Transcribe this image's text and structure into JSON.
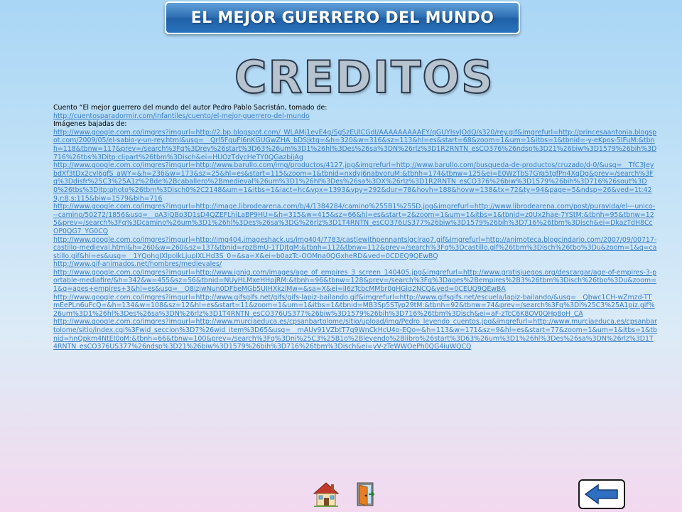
{
  "header": {
    "title": "EL MEJOR GUERRERO DEL MUNDO"
  },
  "main": {
    "heading": "CREDITOS",
    "intro_text": "Cuento “El mejor guerrero del mundo del autor Pedro Pablo Sacristán, tomado de:",
    "story_link": "http://cuentosparadormir.com/infantiles/cuento/el-mejor-guerrero-del-mundo",
    "images_label": "Imágenes bajadas de:",
    "image_links": [
      "http://www.google.com.co/imgres?imgurl=http://2.bp.blogspot.com/_WLAMj1evE4g/SgSzEUlCGdI/AAAAAAAAAEY/qGUYIsvJOdQ/s320/rey.gif&imgrefurl=http://princesaantonia.blogspot.com/2009/05/el-sabio-y-un-rey.html&usg=__Qrl5FguFI6nKGUGwZHA_bDSJktg=&h=320&w=316&sz=113&hl=es&start=68&zoom=1&um=1&itbs=1&tbnid=-y-eKpos-5IFuM:&tbnh=118&tbnw=117&prev=/search%3Fq%3Drey%26start%3D63%26um%3D1%26hl%3Des%26sa%3DN%26rlz%3D1R2RNTN_esCO376%26ndsp%3D21%26biw%3D1579%26bih%3D716%26tbs%3Ditp:clipart%26tbm%3Disch&ei=HUOzTdycHeTY0QGazbijAg",
      "http://www.google.com.co/imgres?imgurl=http://www.barullo.com/img/productos/4127.jpg&imgrefurl=http://www.barullo.com/busqueda-de-productos/cruzado/d-0/&usg=__TfC3JeybdXf3tDx2cvl6gfS_aWY=&h=236&w=173&sz=25&hl=es&start=115&zoom=1&tbnid=nxdyj6nabvoruM:&tbnh=174&tbnw=125&ei=E0WzTbS7GYa5tgfPn4XqDg&prev=/search%3Fq%3Ddisfr%25C3%25A1z%2Bde%2Bcaballero%2Bmedieval%26um%3D1%26hl%3Des%26sa%3DX%26rlz%3D1R2RNTN_esCO376%26biw%3D1579%26bih%3D716%26sout%3D0%26tbs%3Ditp:photo%26tbm%3Disch0%2C2148&um=1&itbs=1&iact=hc&vpx=1393&vpy=292&dur=78&hovh=188&hovw=138&tx=72&ty=94&page=5&ndsp=26&ved=1t:429,r:8,s:115&biw=1579&bih=716",
      "http://www.google.com.co/imgres?imgurl=http://image.librodearena.com/b/4/1384284/camino%255B1%255D.jpg&imgrefurl=http://www.librodearena.com/post/puravida/el---unico---camino/50272/1856&usg=__oA3jQBp3D1sD4QZEFLhiLaBP9HU=&h=315&w=415&sz=66&hl=es&start=2&zoom=1&um=1&itbs=1&tbnid=z0Ux2hae-7YStM:&tbnh=95&tbnw=125&prev=/search%3Fq%3Dcamino%26um%3D1%26hl%3Des%26sa%3DG%26rlz%3D1T4RNTN_esCO376US377%26biw%3D1579%26bih%3D716%26tbm%3Disch&ei=DkazTdH8CcOP0QG7_YG0CQ",
      "http://www.google.com.co/imgres?imgurl=http://img404.imageshack.us/img404/7783/castlewithpennantslgclrao7.gif&imgrefurl=http://animoteca.blogcindario.com/2007/09/00717-castillo-medieval.html&h=260&w=260&sz=137&tbnid=rpzBmU-1TDJtgM:&tbnh=112&tbnw=112&prev=/search%3Fq%3Dcastillo.gif%26tbm%3Disch%26tbo%3Du&zoom=1&q=castillo.gif&hl=es&usg=__1YQohgJXlpolkLjuplXLHd3S_0=&sa=X&ei=b0azTc-OOMna0QGxheRD&ved=0CDEQ9QEwBQ",
      "http://www.gif-animados.net/hombres/medievales/",
      "http://www.google.com.co/imgres?imgurl=http://www.ignig.com/images/age_of_empires_3_screen_140405.jpg&imgrefurl=http://www.gratisjuegos.org/descargar/age-of-empires-3-portable-mediafire/&h=342&w=455&sz=56&tbnid=NUyHLMxeHHpjRM:&tbnh=96&tbnw=128&prev=/search%3Fq%3Dages%2Bempires%2B3%26tbm%3Disch%26tbo%3Du&zoom=1&q=ages+empires+3&hl=es&usg=__O8izjwNun0DFbeMGb5UIHXkzlMw=&sa=X&ei=iI6zTcbcMMbr0gHGlq2NCQ&ved=0CEUQ9QEwBA",
      "http://www.google.com.co/imgres?imgurl=http://www.gifsgifs.net/gifs/gifs-lapiz-bailando.gif&imgrefurl=http://www.gifsgifs.net/escuela/lapiz-bailando/&usg=__Qbwc1CH-wZmzd-TTmEePLn6uFcQ=&h=134&w=108&sz=12&hl=es&start=11&zoom=1&um=1&itbs=1&tbnid=MB3Sp5STyp29tM:&tbnh=92&tbnw=74&prev=/search%3Fq%3Dl%25C3%25A1piz.gif%26um%3D1%26hl%3Des%26sa%3DN%26rlz%3D1T4RNTN_esCO376US377%26biw%3D1579%26bih%3D716%26tbm%3Disch&ei=aF-zTcC6K8OV0QHp8oH_CA",
      "http://www.google.com.co/imgres?imgurl=http://www.murciaeduca.es/cpsanbartolome/sitio/upload/img/Pedro_leyendo_cuentos.jpg&imgrefurl=http://www.murciaeduca.es/cpsanbartolome/sitio/index.cgi%3Fwid_seccion%3D7%26wid_item%3D65&usg=__mAUv91VZbtT7q9WnCkHcU4o-EQo=&h=113&w=171&sz=9&hl=es&start=77&zoom=1&um=1&itbs=1&tbnid=hnQpkm4NtEI0oM:&tbnh=66&tbnw=100&prev=/search%3Fq%3Dni%25C3%25B1o%2Bleyendo%2Blibro%26start%3D63%26um%3D1%26hl%3Des%26sa%3DN%26rlz%3D1T4RNTN_esCO376US377%26ndsp%3D21%26biw%3D1579%26bih%3D716%26tbm%3Disch&ei=yV-zTeWWOePh0QG4iuWQCQ"
    ]
  },
  "navigation": {
    "home_icon": "house-icon",
    "exit_icon": "door-icon",
    "back_icon": "arrow-left-icon"
  },
  "colors": {
    "banner": "#2e6fb4",
    "link": "#3a7ec8",
    "heading_fill": "#b7c4d0"
  }
}
